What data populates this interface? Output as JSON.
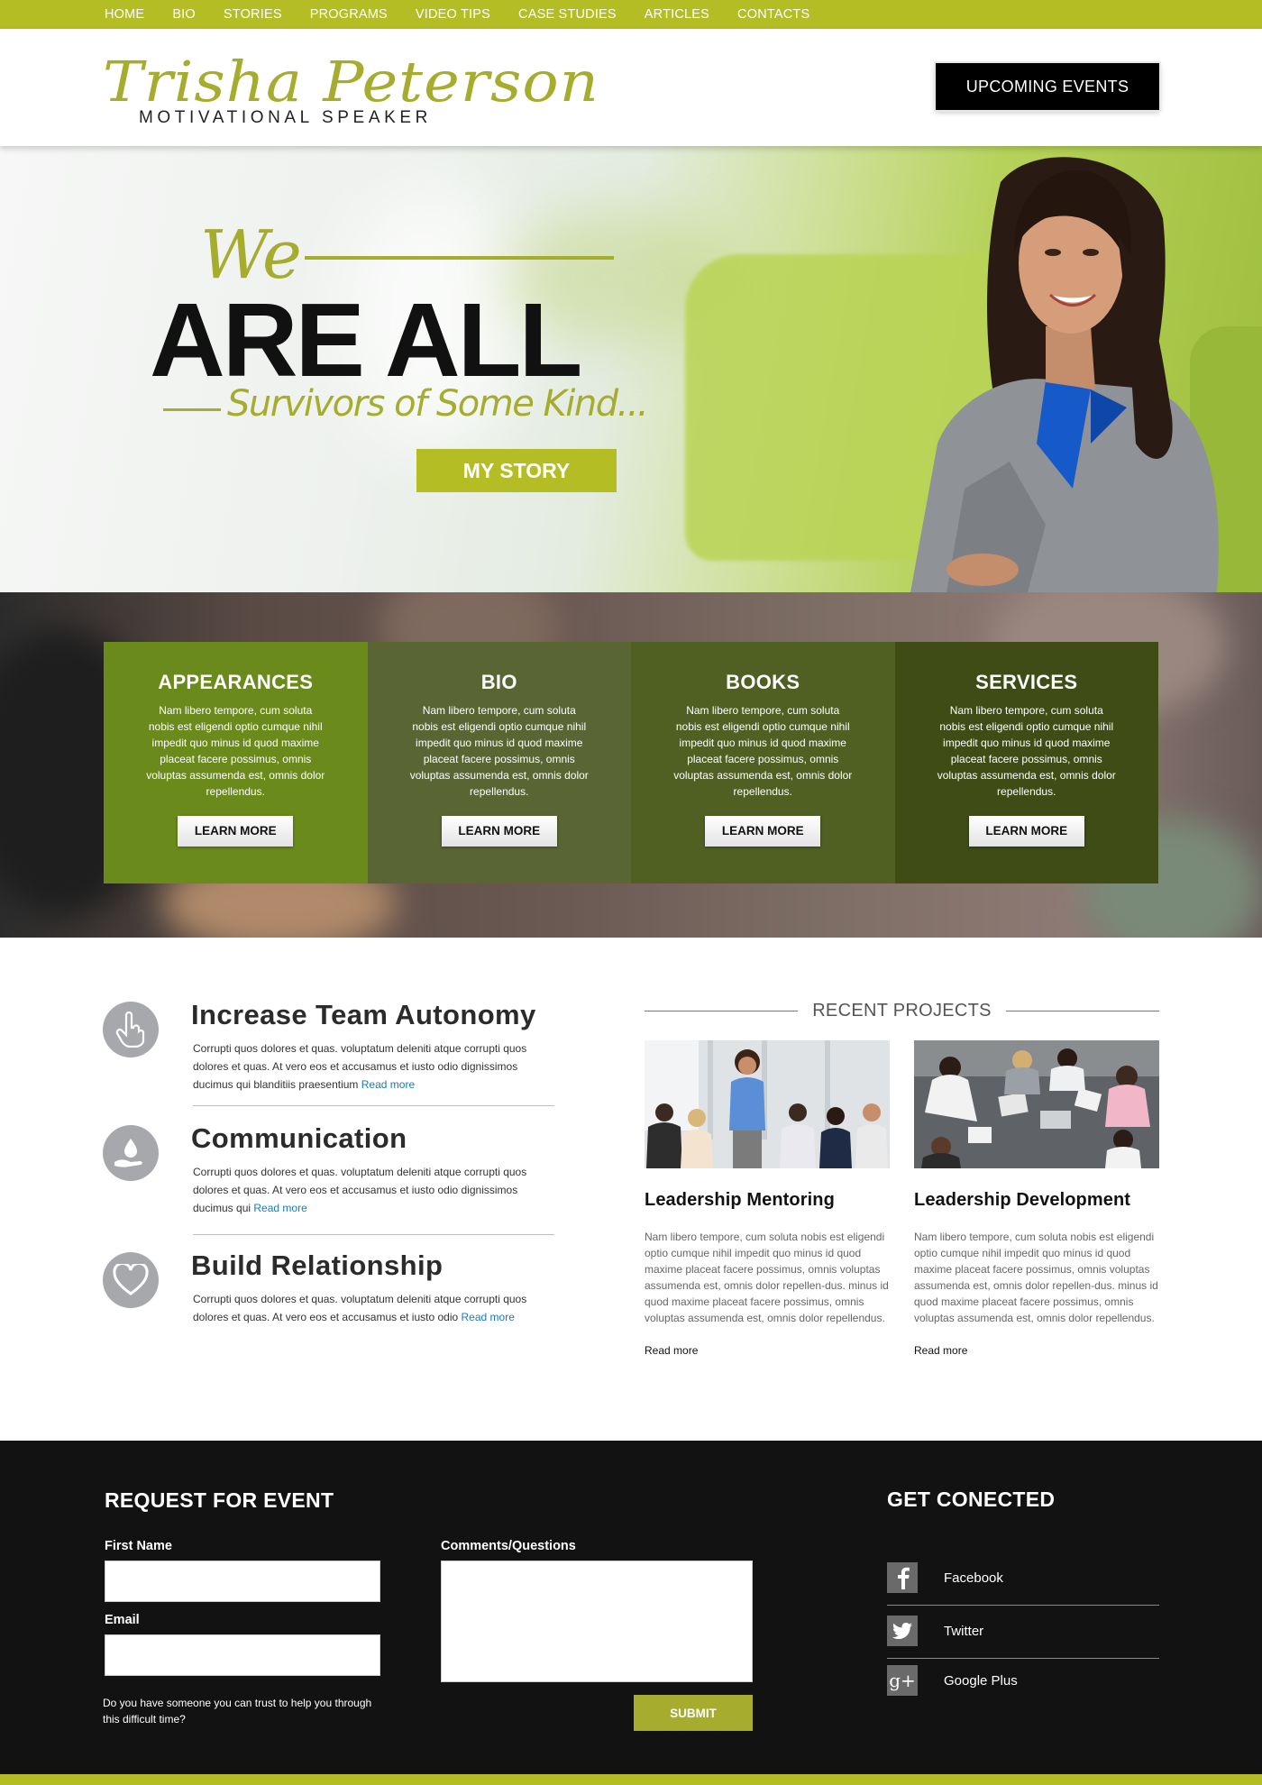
{
  "nav": {
    "items": [
      "HOME",
      "BIO",
      "STORIES",
      "PROGRAMS",
      "VIDEO TIPS",
      "CASE STUDIES",
      "ARTICLES",
      "CONTACTS"
    ]
  },
  "header": {
    "logo_name": "Trisha Peterson",
    "logo_tagline": "MOTIVATIONAL SPEAKER",
    "events_button": "UPCOMING EVENTS"
  },
  "hero": {
    "we": "We",
    "headline": "ARE ALL",
    "subline": "Survivors of Some Kind...",
    "cta": "MY STORY"
  },
  "boxes": [
    {
      "title": "APPEARANCES",
      "text": "Nam libero tempore, cum soluta nobis est eligendi optio cumque nihil impedit quo minus id quod maxime placeat facere possimus, omnis voluptas assumenda est, omnis dolor repellendus.",
      "button": "LEARN MORE",
      "color": "#6b8a1c"
    },
    {
      "title": "BIO",
      "text": "Nam libero tempore, cum soluta nobis est eligendi optio cumque nihil impedit quo minus id quod maxime placeat facere possimus, omnis voluptas assumenda est, omnis dolor repellendus.",
      "button": "LEARN MORE",
      "color": "#5a6534"
    },
    {
      "title": "BOOKS",
      "text": "Nam libero tempore, cum soluta nobis est eligendi optio cumque nihil impedit quo minus id quod maxime placeat facere possimus, omnis voluptas assumenda est, omnis dolor repellendus.",
      "button": "LEARN MORE",
      "color": "#4f6022"
    },
    {
      "title": "SERVICES",
      "text": "Nam libero tempore, cum soluta nobis est eligendi optio cumque nihil impedit quo minus id quod maxime placeat facere possimus, omnis voluptas assumenda est, omnis dolor repellendus.",
      "button": "LEARN MORE",
      "color": "#3f4c16"
    }
  ],
  "features": [
    {
      "title": "Increase Team Autonomy",
      "text": "Corrupti quos dolores et quas. voluptatum deleniti atque corrupti quos dolores et quas. At vero eos et accusamus et iusto odio dignissimos ducimus qui blanditiis praesentium ",
      "link": "Read more",
      "icon": "hand-pointer-icon"
    },
    {
      "title": "Communication",
      "text": "Corrupti quos dolores et quas. voluptatum deleniti atque corrupti quos dolores et quas. At vero eos et accusamus et iusto odio dignissimos ducimus qui ",
      "link": "Read more",
      "icon": "hand-drop-icon"
    },
    {
      "title": "Build Relationship",
      "text": "Corrupti quos dolores et quas. voluptatum deleniti atque corrupti quos dolores et quas. At vero eos et accusamus et iusto odio ",
      "link": "Read more",
      "icon": "heart-icon"
    }
  ],
  "recent_projects": {
    "heading": "RECENT PROJECTS",
    "items": [
      {
        "title": "Leadership Mentoring",
        "text": "Nam libero tempore, cum soluta nobis est eligendi optio cumque nihil impedit quo minus id quod maxime placeat facere possimus, omnis voluptas assumenda est, omnis dolor repellen-dus. minus id quod maxime placeat facere possimus, omnis voluptas assumenda est, omnis dolor repellendus.",
        "link": "Read more"
      },
      {
        "title": "Leadership Development",
        "text": "Nam libero tempore, cum soluta nobis est eligendi optio cumque nihil impedit quo minus id quod maxime placeat facere possimus, omnis voluptas assumenda est, omnis dolor repellen-dus. minus id quod maxime placeat facere possimus, omnis voluptas assumenda est, omnis dolor repellendus.",
        "link": "Read more"
      }
    ]
  },
  "footer": {
    "request_heading": "REQUEST FOR EVENT",
    "first_name_label": "First Name",
    "email_label": "Email",
    "comments_label": "Comments/Questions",
    "note": "Do you have someone you can trust to help you through this difficult time?",
    "submit": "SUBMIT",
    "connect_heading": "GET CONECTED",
    "social": [
      {
        "name": "Facebook",
        "icon": "facebook-icon",
        "glyph": "f"
      },
      {
        "name": "Twitter",
        "icon": "twitter-icon",
        "glyph": "t"
      },
      {
        "name": "Google Plus",
        "icon": "google-plus-icon",
        "glyph": "g+"
      }
    ]
  },
  "colors": {
    "accent": "#b5bd24",
    "dark": "#121212",
    "link": "#1a7ab8"
  }
}
